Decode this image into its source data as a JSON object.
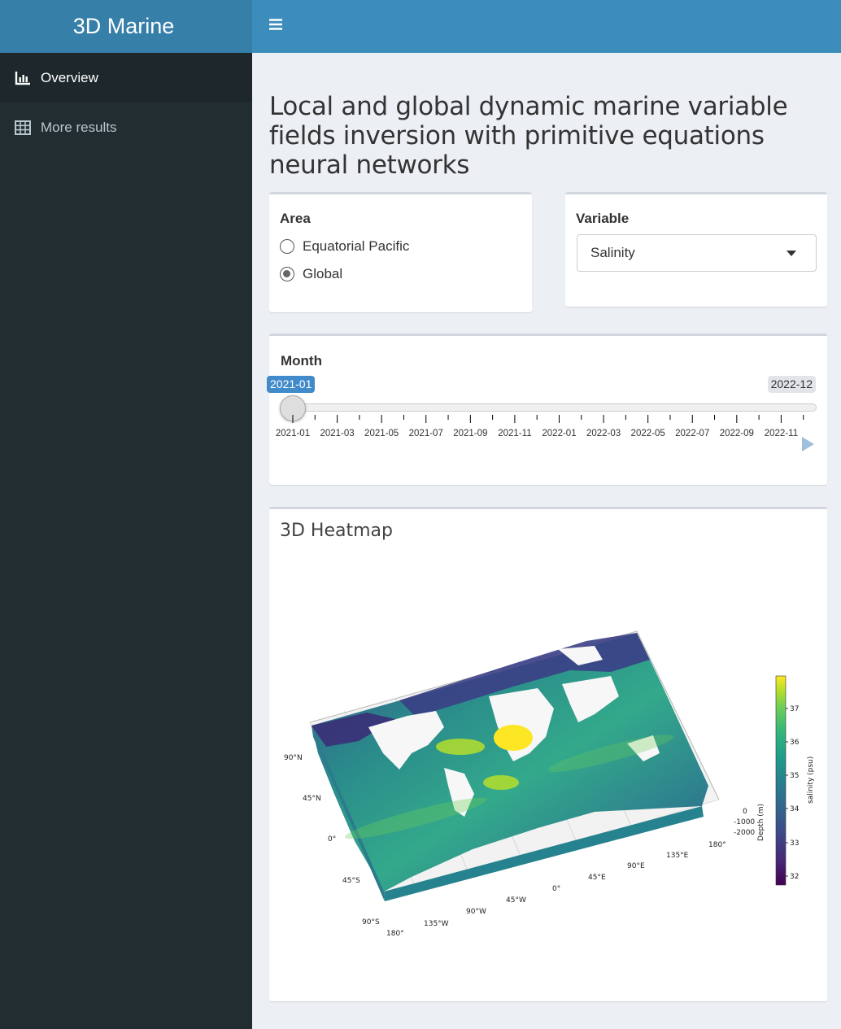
{
  "app": {
    "title": "3D Marine"
  },
  "sidebar": {
    "items": [
      {
        "label": "Overview",
        "icon": "bar-chart-icon"
      },
      {
        "label": "More results",
        "icon": "table-icon"
      }
    ]
  },
  "main": {
    "title": "Local and global dynamic marine variable fields inversion with primitive equations neural networks",
    "area": {
      "label": "Area",
      "options": [
        "Equatorial Pacific",
        "Global"
      ],
      "selected": "Global"
    },
    "variable": {
      "label": "Variable",
      "selected": "Salinity"
    },
    "month": {
      "label": "Month",
      "min": "2021-01",
      "max": "2022-12",
      "value": "2021-01",
      "tick_labels": [
        "2021-01",
        "2021-03",
        "2021-05",
        "2021-07",
        "2021-09",
        "2021-11",
        "2022-01",
        "2022-03",
        "2022-05",
        "2022-07",
        "2022-09",
        "2022-11"
      ]
    },
    "heatmap": {
      "title": "3D Heatmap",
      "lat_labels": [
        "90°N",
        "45°N",
        "0°",
        "45°S",
        "90°S"
      ],
      "lon_labels": [
        "180°",
        "135°W",
        "90°W",
        "45°W",
        "0°",
        "45°E",
        "90°E",
        "135°E",
        "180°"
      ],
      "depth_labels": [
        "0",
        "-1000",
        "-2000"
      ],
      "depth_axis_label": "Depth (m)",
      "colorbar_label": "salinity (psu)",
      "colorbar_ticks": [
        "37",
        "36",
        "35",
        "34",
        "33",
        "32"
      ],
      "colormap": [
        "#440154",
        "#482878",
        "#3e4989",
        "#31688e",
        "#26828e",
        "#1f9e89",
        "#35b779",
        "#6ece58",
        "#b5de2b",
        "#fde725"
      ]
    }
  }
}
